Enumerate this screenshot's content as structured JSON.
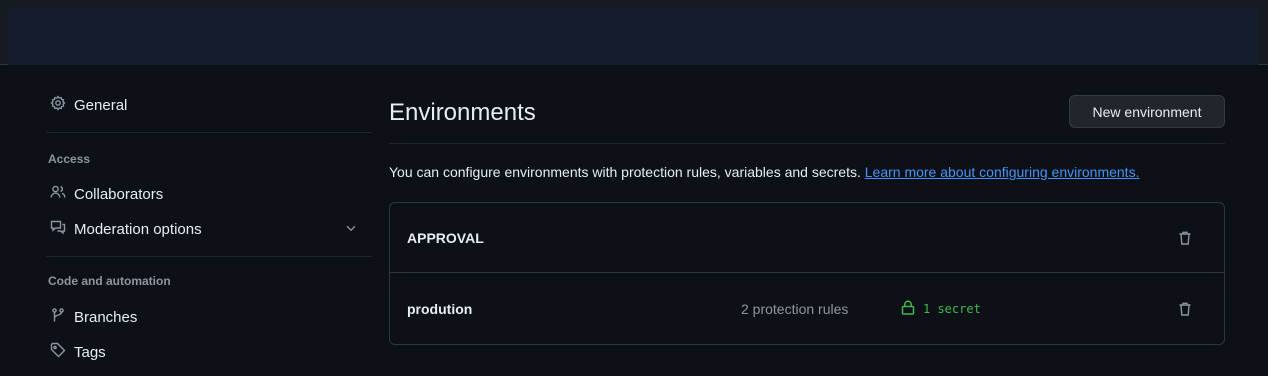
{
  "sidebar": {
    "general": {
      "label": "General",
      "icon": "gear-icon"
    },
    "access_section": "Access",
    "collaborators": {
      "label": "Collaborators",
      "icon": "people-icon"
    },
    "moderation": {
      "label": "Moderation options",
      "icon": "comment-icon"
    },
    "code_section": "Code and automation",
    "branches": {
      "label": "Branches",
      "icon": "branch-icon"
    },
    "tags": {
      "label": "Tags",
      "icon": "tag-icon"
    }
  },
  "main": {
    "title": "Environments",
    "new_button": "New environment",
    "description": "You can configure environments with protection rules, variables and secrets.",
    "learn_more": "Learn more about configuring environments.",
    "environments": [
      {
        "name": "APPROVAL",
        "rules": "",
        "secrets": ""
      },
      {
        "name": "prodution",
        "rules": "2 protection rules",
        "secrets": "1 secret"
      }
    ]
  },
  "colors": {
    "background": "#0d1117",
    "link": "#4493f8",
    "secret_green": "#3fb950"
  }
}
